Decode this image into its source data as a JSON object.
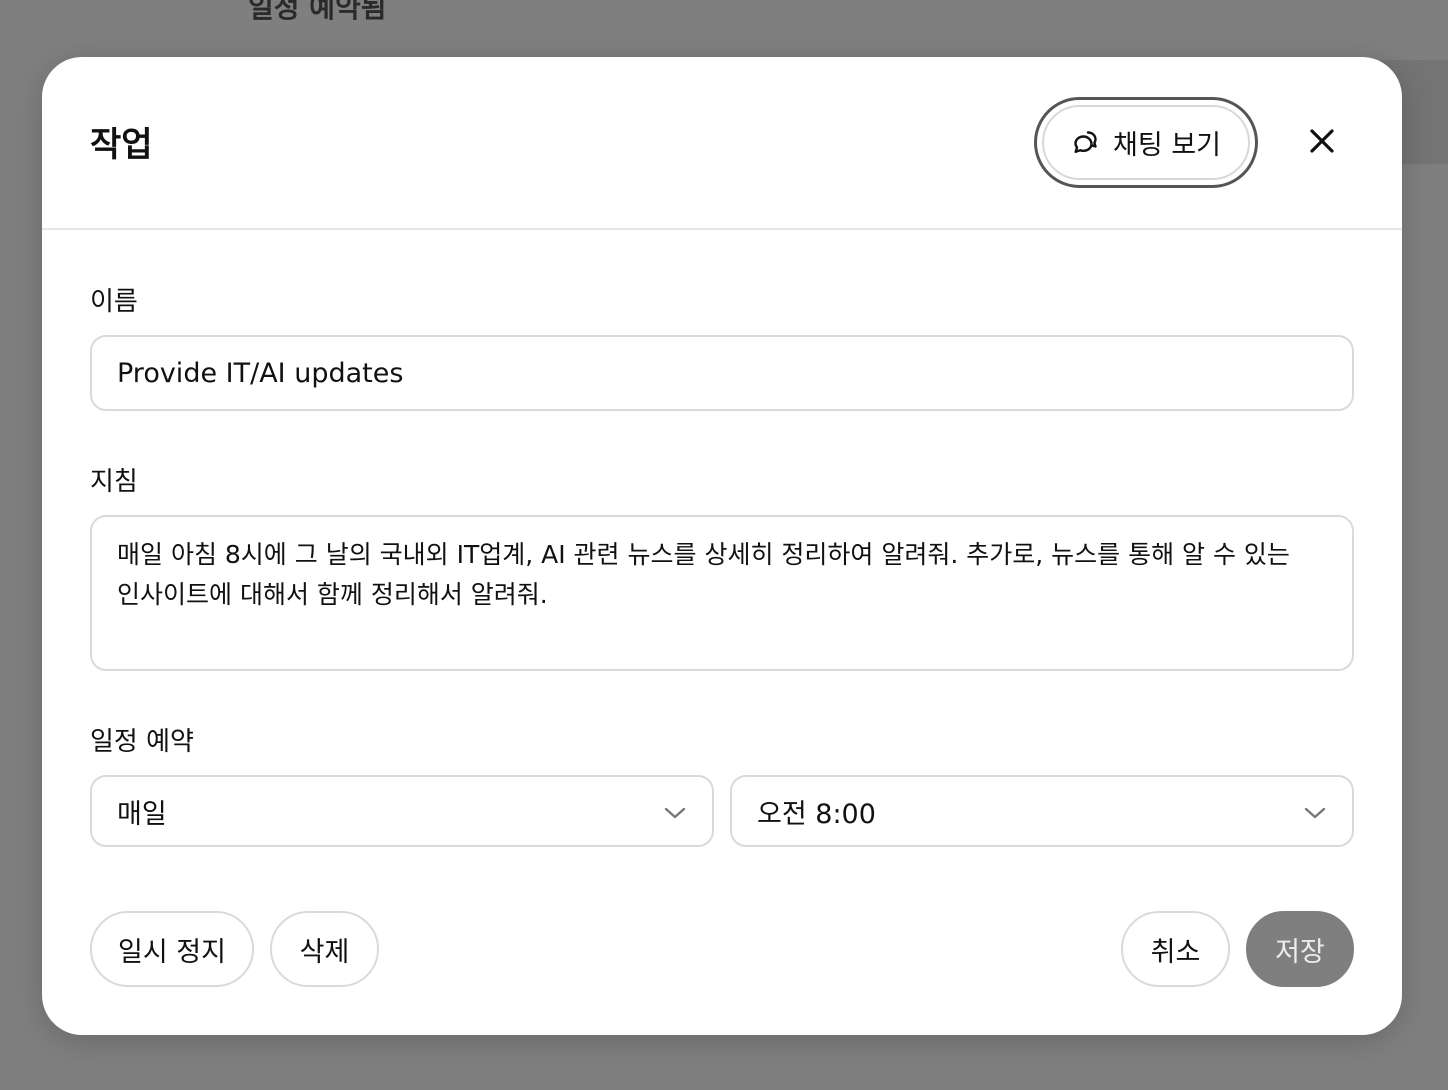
{
  "backdrop": {
    "section_title": "일정 예약됨"
  },
  "modal": {
    "title": "작업",
    "chat_button_label": "채팅 보기",
    "chat_icon": "chat-bubbles-icon",
    "close_icon": "close-icon"
  },
  "form": {
    "name": {
      "label": "이름",
      "value": "Provide IT/AI updates"
    },
    "instructions": {
      "label": "지침",
      "value": "매일 아침 8시에 그 날의 국내외 IT업계, AI 관련 뉴스를 상세히 정리하여 알려줘. 추가로, 뉴스를 통해 알 수 있는 인사이트에 대해서 함께 정리해서 알려줘."
    },
    "schedule": {
      "label": "일정 예약",
      "frequency": "매일",
      "time": "오전 8:00",
      "chevron_icon": "chevron-down-icon"
    }
  },
  "actions": {
    "pause_label": "일시 정지",
    "delete_label": "삭제",
    "cancel_label": "취소",
    "save_label": "저장"
  },
  "colors": {
    "overlay": "#7f7f7f",
    "primary_disabled": "#7f7f7f",
    "border": "#dadada"
  }
}
